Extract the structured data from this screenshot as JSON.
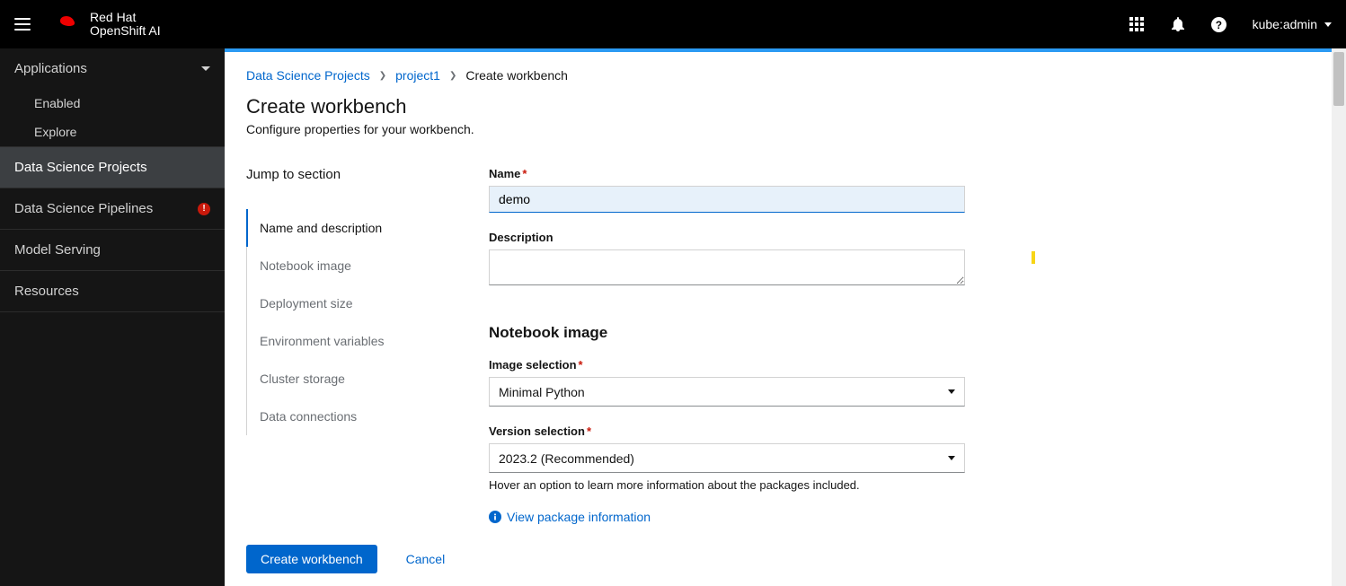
{
  "brand": {
    "top": "Red Hat",
    "bottom": "OpenShift AI"
  },
  "user": {
    "name": "kube:admin"
  },
  "sidenav": {
    "applications": {
      "label": "Applications",
      "enabled": "Enabled",
      "explore": "Explore"
    },
    "dsp": "Data Science Projects",
    "pipelines": "Data Science Pipelines",
    "serving": "Model Serving",
    "resources": "Resources"
  },
  "breadcrumb": {
    "root": "Data Science Projects",
    "project": "project1",
    "current": "Create workbench"
  },
  "page": {
    "title": "Create workbench",
    "subtitle": "Configure properties for your workbench."
  },
  "jump": {
    "title": "Jump to section",
    "items": [
      "Name and description",
      "Notebook image",
      "Deployment size",
      "Environment variables",
      "Cluster storage",
      "Data connections"
    ]
  },
  "form": {
    "name_label": "Name",
    "name_value": "demo",
    "desc_label": "Description",
    "desc_value": "",
    "notebook_heading": "Notebook image",
    "image_label": "Image selection",
    "image_value": "Minimal Python",
    "version_label": "Version selection",
    "version_value": "2023.2 (Recommended)",
    "version_help": "Hover an option to learn more information about the packages included.",
    "package_link": "View package information"
  },
  "footer": {
    "create": "Create workbench",
    "cancel": "Cancel"
  }
}
